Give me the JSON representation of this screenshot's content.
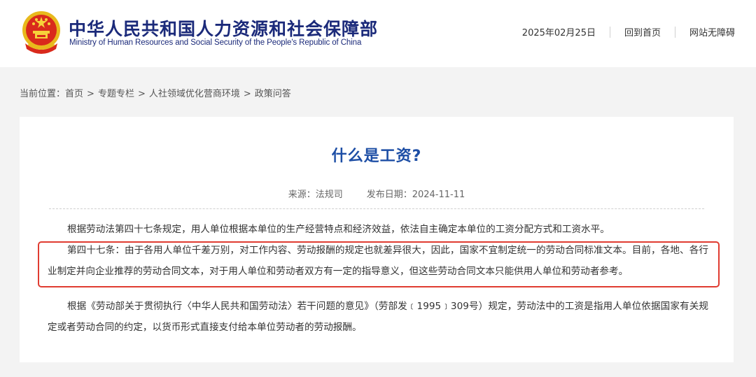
{
  "header": {
    "title_cn": "中华人民共和国人力资源和社会保障部",
    "title_en": "Ministry of Human Resources and Social Security of the People's Republic of China",
    "date": "2025年02月25日",
    "links": [
      "回到首页",
      "网站无障碍"
    ],
    "emblem_icon": "national-emblem-icon"
  },
  "breadcrumb": {
    "prefix": "当前位置：",
    "items": [
      "首页",
      "专题专栏",
      "人社领域优化营商环境",
      "政策问答"
    ],
    "separator": ">"
  },
  "article": {
    "title": "什么是工资?",
    "source": "来源：法规司",
    "publish_date": "发布日期：2024-11-11",
    "paragraphs": [
      "根据劳动法第四十七条规定，用人单位根据本单位的生产经营特点和经济效益，依法自主确定本单位的工资分配方式和工资水平。",
      "第四十七条：由于各用人单位千差万别，对工作内容、劳动报酬的规定也就差异很大，因此，国家不宜制定统一的劳动合同标准文本。目前，各地、各行业制定并向企业推荐的劳动合同文本，对于用人单位和劳动者双方有一定的指导意义，但这些劳动合同文本只能供用人单位和劳动者参考。",
      "根据《劳动部关于贯彻执行〈中华人民共和国劳动法〉若干问题的意见》（劳部发﹝1995﹞309号）规定，劳动法中的工资是指用人单位依据国家有关规定或者劳动合同的约定，以货币形式直接支付给本单位劳动者的劳动报酬。"
    ]
  },
  "colors": {
    "brand": "#1b2a7a",
    "title": "#1d4ea5",
    "highlight_border": "#e03c31",
    "background": "#f3f3f3"
  }
}
